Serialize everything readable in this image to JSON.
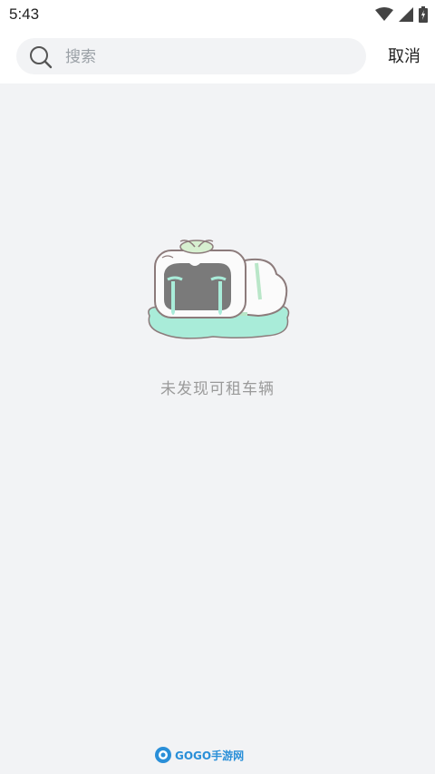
{
  "status_bar": {
    "time": "5:43"
  },
  "search": {
    "placeholder": "搜索",
    "cancel_label": "取消"
  },
  "empty_state": {
    "message": "未发现可租车辆"
  },
  "watermark": {
    "text": "GOGO手游网"
  },
  "colors": {
    "accent": "#27c08a",
    "background": "#f2f3f5"
  }
}
